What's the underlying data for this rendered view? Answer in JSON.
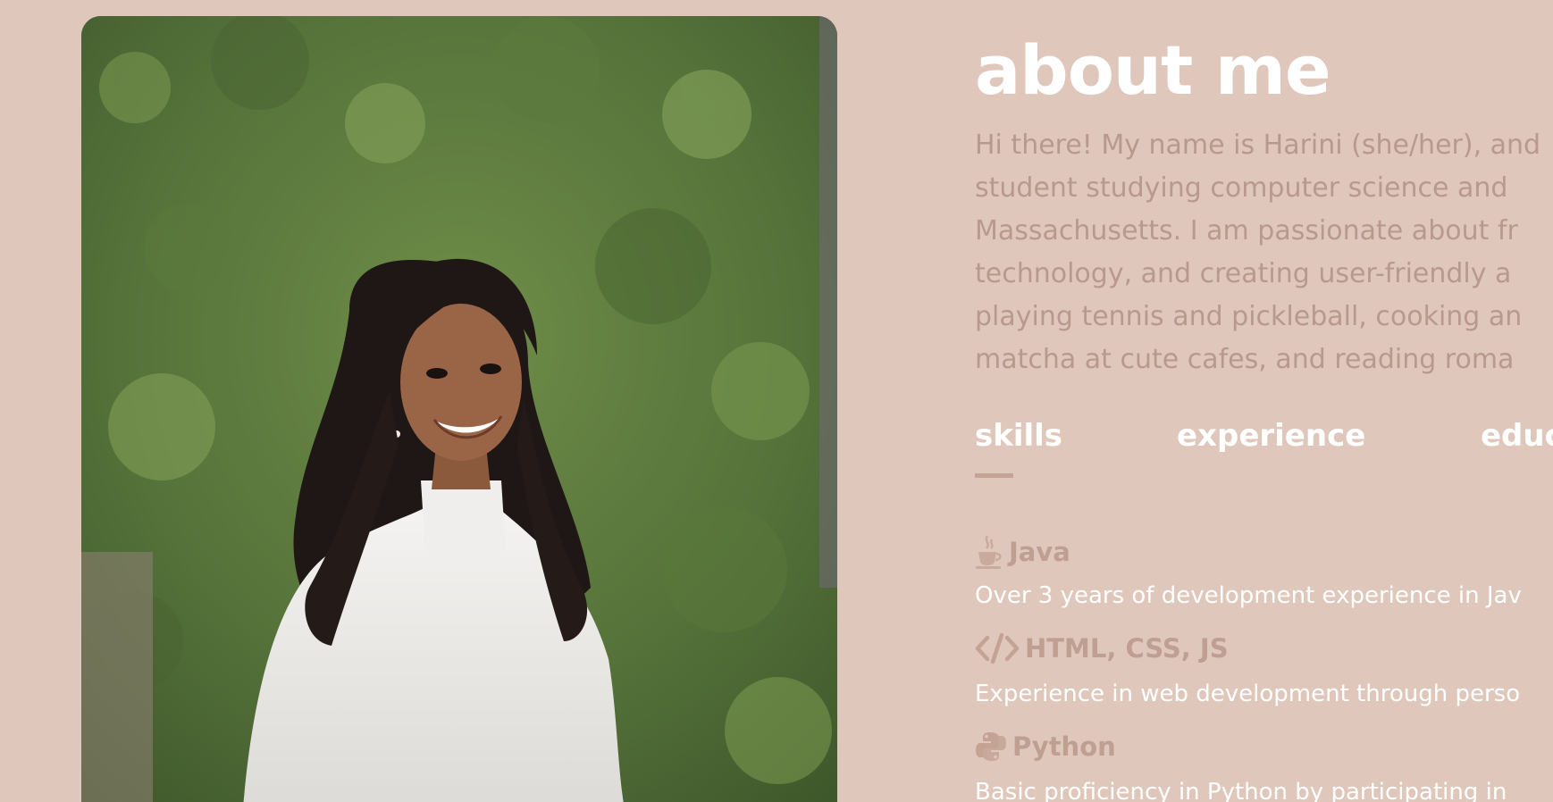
{
  "about": {
    "title": "about me",
    "bio_lines": [
      "Hi there! My name is Harini (she/her), and",
      "student studying computer science and",
      "Massachusetts. I am passionate about fr",
      "technology, and creating user-friendly a",
      "playing tennis and pickleball, cooking an",
      "matcha at cute cafes, and reading roma"
    ]
  },
  "tabs": [
    {
      "label": "skills",
      "active": true
    },
    {
      "label": "experience",
      "active": false
    },
    {
      "label": "educ",
      "active": false
    }
  ],
  "skills": [
    {
      "icon": "coffee-cup-icon",
      "title": "Java",
      "description": "Over 3 years of development experience in Jav"
    },
    {
      "icon": "code-brackets-icon",
      "title": "HTML, CSS, JS",
      "description": "Experience in web development through perso"
    },
    {
      "icon": "python-icon",
      "title": "Python",
      "description": "Basic proficiency in Python by participating in"
    }
  ],
  "colors": {
    "background": "#dfc8bb",
    "heading": "#ffffff",
    "muted_text": "#b79a8d",
    "accent": "#c4a395"
  }
}
